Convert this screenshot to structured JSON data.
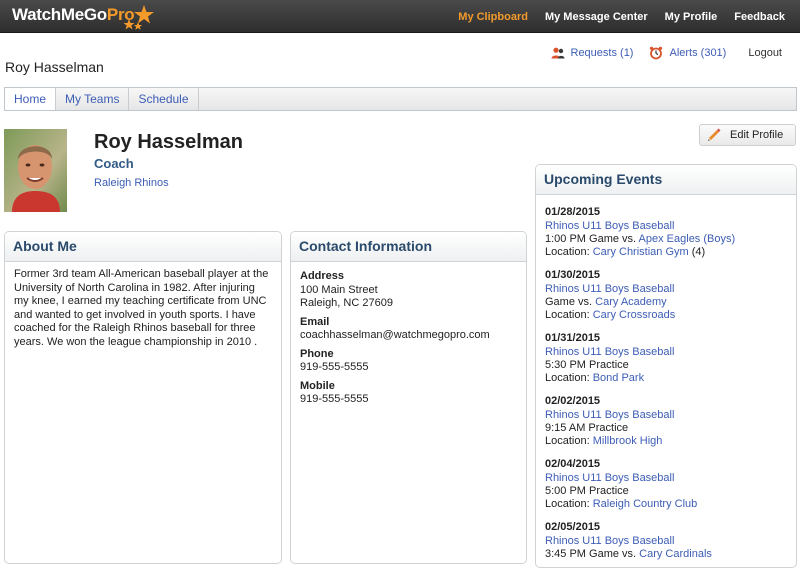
{
  "brand": {
    "logo_main": "WatchMeGo",
    "logo_accent": "Pro"
  },
  "topnav": {
    "clipboard": "My Clipboard",
    "messages": "My Message Center",
    "profile": "My Profile",
    "feedback": "Feedback"
  },
  "user": {
    "name": "Roy Hasselman",
    "requests": "Requests (1)",
    "alerts": "Alerts (301)",
    "logout": "Logout"
  },
  "tabs": [
    "Home",
    "My Teams",
    "Schedule"
  ],
  "profile": {
    "name": "Roy Hasselman",
    "role": "Coach",
    "team": "Raleigh Rhinos",
    "edit_label": "Edit Profile"
  },
  "about": {
    "title": "About Me",
    "text": "Former 3rd team All-American baseball player at the University of North Carolina in 1982. After injuring my knee, I earned my teaching certificate from UNC and wanted to get involved in youth sports. I have coached for the Raleigh Rhinos baseball for three years. We won the league championship in 2010 ."
  },
  "contact": {
    "title": "Contact Information",
    "address_label": "Address",
    "address_line1": "100 Main Street",
    "address_line2": "Raleigh, NC 27609",
    "email_label": "Email",
    "email": "coachhasselman@watchmegopro.com",
    "phone_label": "Phone",
    "phone": "919-555-5555",
    "mobile_label": "Mobile",
    "mobile": "919-555-5555"
  },
  "events": {
    "title": "Upcoming Events",
    "items": [
      {
        "date": "01/28/2015",
        "team": "Rhinos U11 Boys Baseball",
        "line": "1:00 PM Game vs.",
        "opponent": "Apex Eagles (Boys)",
        "loc_label": "Location:",
        "location": "Cary Christian Gym",
        "loc_extra": "(4)"
      },
      {
        "date": "01/30/2015",
        "team": "Rhinos U11 Boys Baseball",
        "line": "Game vs.",
        "opponent": "Cary Academy",
        "loc_label": "Location:",
        "location": "Cary Crossroads",
        "loc_extra": ""
      },
      {
        "date": "01/31/2015",
        "team": "Rhinos U11 Boys Baseball",
        "line": "5:30 PM Practice",
        "opponent": "",
        "loc_label": "Location:",
        "location": "Bond Park",
        "loc_extra": ""
      },
      {
        "date": "02/02/2015",
        "team": "Rhinos U11 Boys Baseball",
        "line": "9:15 AM Practice",
        "opponent": "",
        "loc_label": "Location:",
        "location": "Millbrook High",
        "loc_extra": ""
      },
      {
        "date": "02/04/2015",
        "team": "Rhinos U11 Boys Baseball",
        "line": "5:00 PM Practice",
        "opponent": "",
        "loc_label": "Location:",
        "location": "Raleigh Country Club",
        "loc_extra": ""
      },
      {
        "date": "02/05/2015",
        "team": "Rhinos U11 Boys Baseball",
        "line": "3:45 PM Game vs.",
        "opponent": "Cary Cardinals",
        "loc_label": "",
        "location": "",
        "loc_extra": ""
      }
    ]
  },
  "colors": {
    "accent": "#f39a2b",
    "link": "#3d5db5",
    "heading": "#2a4a6b",
    "topbar": "#3a3a3a"
  },
  "icons": {
    "requests": "users-icon",
    "alerts": "alarm-clock-icon",
    "edit": "pencil-icon",
    "logo": "stars-icon"
  }
}
